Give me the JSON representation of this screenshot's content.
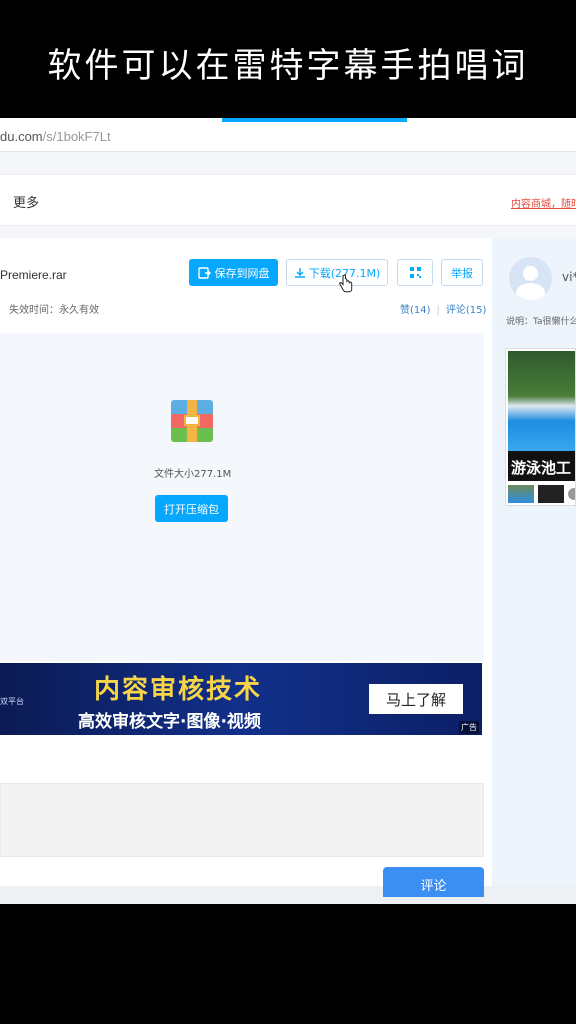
{
  "caption": "软件可以在雷特字幕手拍唱词",
  "browser": {
    "url_host": "du.com",
    "url_path": "/s/1bokF7Lt"
  },
  "nav": {
    "more": "更多",
    "right_link": "内容商城，随时"
  },
  "file": {
    "name": "Premiere.rar",
    "expire": "失效时间：永久有效",
    "size_text": "文件大小277.1M",
    "save_button": "保存到网盘",
    "download_button": "下载(277.1M)",
    "report_button": "举报",
    "likes": "赞(14)",
    "comments": "评论(15)",
    "open_button": "打开压缩包"
  },
  "ad": {
    "left_text": "双平台",
    "title": "内容审核技术",
    "subtitle": "高效审核文字·图像·视频",
    "cta": "马上了解",
    "tag": "广告"
  },
  "comment": {
    "submit": "评论"
  },
  "sidebar": {
    "user_name": "vi*",
    "description": "说明：Ta很懒什么",
    "ad_caption": "游泳池工"
  },
  "colors": {
    "accent": "#06a7ff",
    "comment_button": "#3c8ff2",
    "ad_background": "#12308a",
    "ad_title": "#f7d547"
  }
}
